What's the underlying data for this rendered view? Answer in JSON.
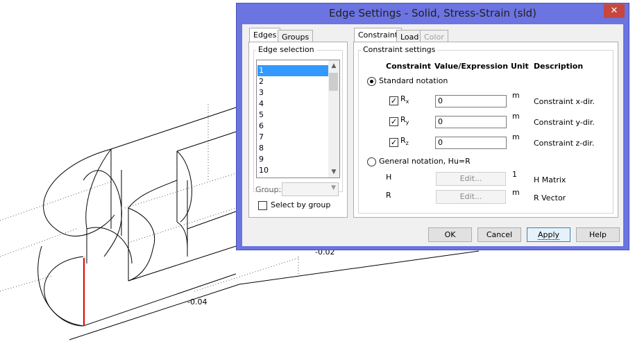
{
  "background": {
    "axis_labels": [
      "-0.02",
      "-0.04"
    ]
  },
  "dialog": {
    "title": "Edge Settings - Solid, Stress-Strain (sld)",
    "close": "✕",
    "left_tabs": [
      "Edges",
      "Groups"
    ],
    "edge_selection_title": "Edge selection",
    "edge_items": [
      "1",
      "2",
      "3",
      "4",
      "5",
      "6",
      "7",
      "8",
      "9",
      "10"
    ],
    "selected_edge": "1",
    "group_label": "Group:",
    "group_value": "",
    "select_by_group_label": "Select by group",
    "right_tabs": [
      "Constraint",
      "Load",
      "Color"
    ],
    "constraint_settings_title": "Constraint settings",
    "headers": {
      "constraint": "Constraint",
      "value": "Value/Expression",
      "unit": "Unit",
      "description": "Description"
    },
    "standard_notation": "Standard notation",
    "rows": [
      {
        "sym": "R",
        "sub": "x",
        "checked": true,
        "value": "0",
        "unit": "m",
        "desc": "Constraint x-dir."
      },
      {
        "sym": "R",
        "sub": "y",
        "checked": true,
        "value": "0",
        "unit": "m",
        "desc": "Constraint y-dir."
      },
      {
        "sym": "R",
        "sub": "z",
        "checked": true,
        "value": "0",
        "unit": "m",
        "desc": "Constraint z-dir."
      }
    ],
    "general_notation": "General notation, Hu=R",
    "general_rows": [
      {
        "sym": "H",
        "button": "Edit...",
        "unit": "1",
        "desc": "H Matrix"
      },
      {
        "sym": "R",
        "button": "Edit...",
        "unit": "m",
        "desc": "R Vector"
      }
    ],
    "buttons": {
      "ok": "OK",
      "cancel": "Cancel",
      "apply": "Apply",
      "help": "Help"
    },
    "colors": {
      "frame": "#6b74e0",
      "close": "#c7473d",
      "selection": "#3399ff"
    }
  }
}
